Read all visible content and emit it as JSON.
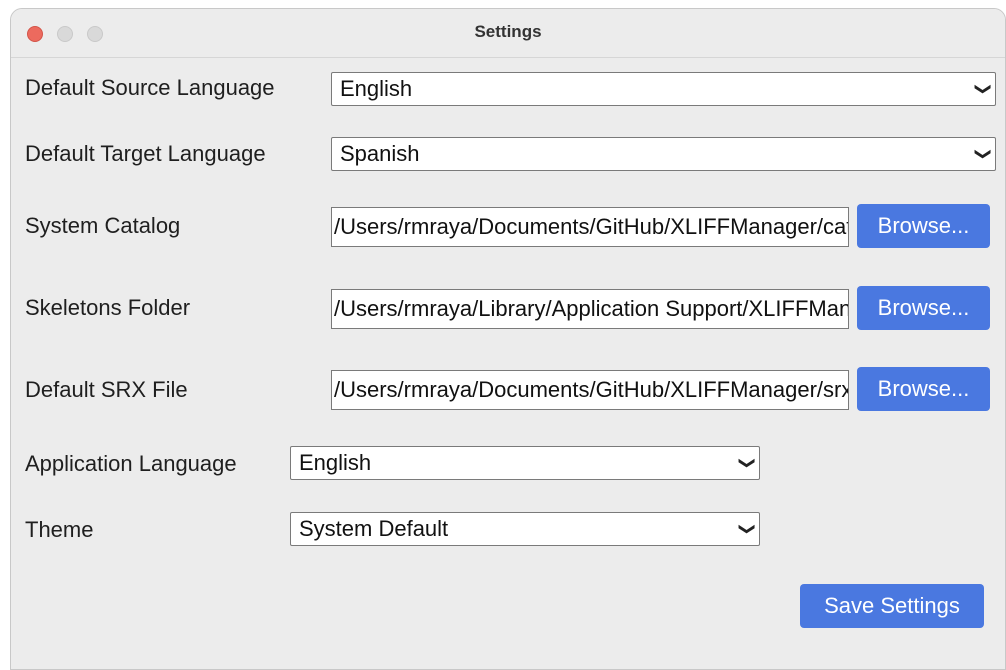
{
  "window": {
    "title": "Settings"
  },
  "fields": {
    "source_language": {
      "label": "Default Source Language",
      "value": "English"
    },
    "target_language": {
      "label": "Default Target Language",
      "value": "Spanish"
    },
    "system_catalog": {
      "label": "System Catalog",
      "value": "/Users/rmraya/Documents/GitHub/XLIFFManager/catalog/catalog.xml",
      "button": "Browse..."
    },
    "skeletons_folder": {
      "label": "Skeletons Folder",
      "value": "/Users/rmraya/Library/Application Support/XLIFFManager/skeletons",
      "button": "Browse..."
    },
    "default_srx": {
      "label": "Default SRX File",
      "value": "/Users/rmraya/Documents/GitHub/XLIFFManager/srx/default.srx",
      "button": "Browse..."
    },
    "app_language": {
      "label": "Application Language",
      "value": "English"
    },
    "theme": {
      "label": "Theme",
      "value": "System Default"
    }
  },
  "actions": {
    "save_label": "Save Settings"
  },
  "colors": {
    "accent": "#4a78e0",
    "close": "#ec6a5e",
    "window_bg": "#ececec"
  }
}
